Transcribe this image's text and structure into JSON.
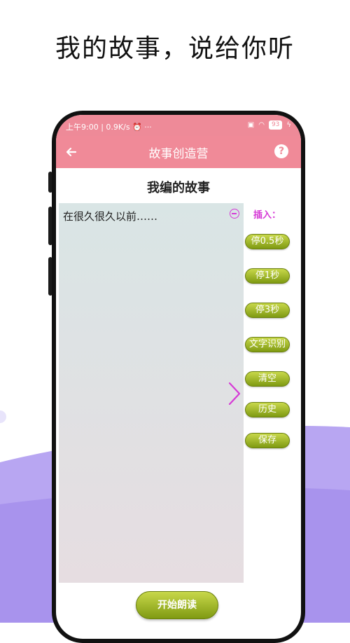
{
  "headline": "我的故事，说给你听",
  "status_bar": {
    "time": "上午9:00 | 0.9K/s ⏰ ···",
    "battery": "93"
  },
  "app_bar": {
    "title": "故事创造营",
    "help": "?"
  },
  "story_heading": "我编的故事",
  "editor": {
    "text": "在很久很久以前……"
  },
  "insert_panel": {
    "label": "插入：",
    "buttons": [
      "停0.5秒",
      "停1秒",
      "停3秒",
      "文字识别",
      "清空",
      "历史",
      "保存"
    ]
  },
  "start_button": "开始朗读",
  "colors": {
    "accent_pink": "#f08a98",
    "pill_green": "#9bb51c",
    "magenta": "#d63ad6"
  }
}
